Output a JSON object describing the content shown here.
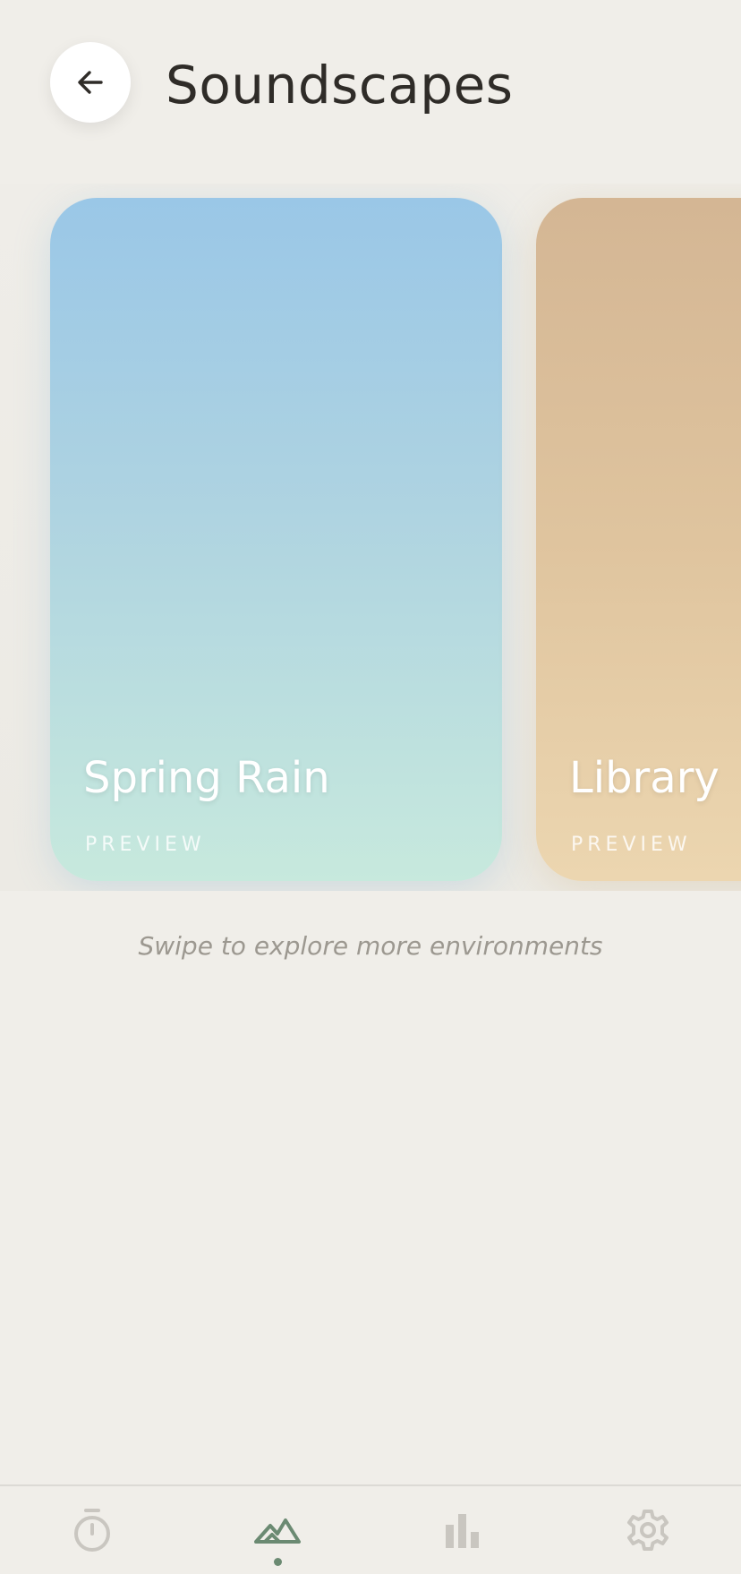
{
  "header": {
    "title": "Soundscapes",
    "back_icon": "arrow-left-icon"
  },
  "carousel": {
    "cards": [
      {
        "title": "Spring Rain",
        "subtitle": "PREVIEW",
        "gradient": [
          "#9ac7e7",
          "#c7e9dd"
        ]
      },
      {
        "title": "Library",
        "subtitle": "PREVIEW",
        "gradient": [
          "#d4b694",
          "#ecd6b0"
        ]
      }
    ]
  },
  "hint": "Swipe to explore more environments",
  "bottom_nav": {
    "items": [
      {
        "icon": "stopwatch-icon",
        "active": false
      },
      {
        "icon": "mountains-icon",
        "active": true
      },
      {
        "icon": "bar-chart-icon",
        "active": false
      },
      {
        "icon": "gear-icon",
        "active": false
      }
    ],
    "active_color": "#6b8a72",
    "inactive_color": "#c9c6c0"
  }
}
